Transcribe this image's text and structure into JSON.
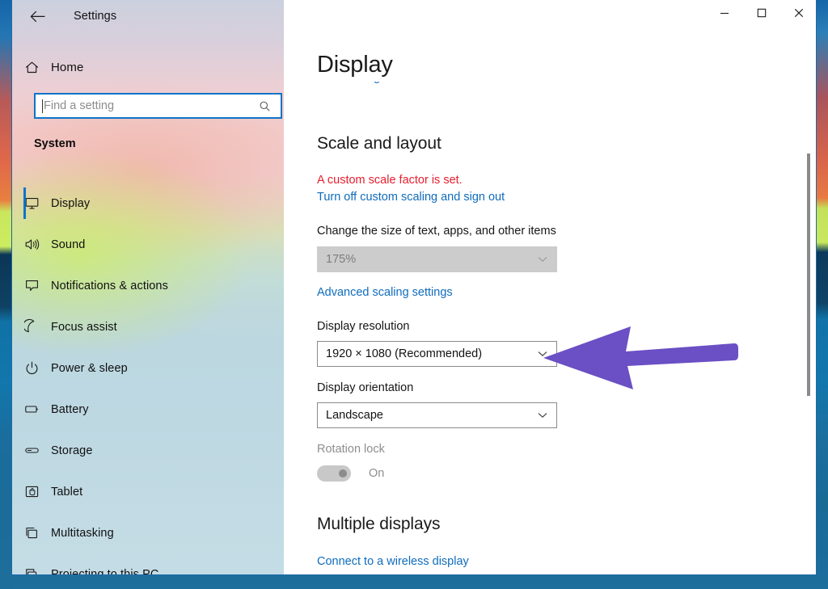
{
  "window": {
    "title": "Settings",
    "back_icon": "back-arrow-icon",
    "controls": [
      {
        "name": "minimize",
        "glyph": "minimize-icon"
      },
      {
        "name": "maximize",
        "glyph": "maximize-icon"
      },
      {
        "name": "close",
        "glyph": "close-icon"
      }
    ]
  },
  "sidebar": {
    "home_label": "Home",
    "home_icon": "home-icon",
    "search": {
      "placeholder": "Find a setting",
      "value": "",
      "icon": "search-icon"
    },
    "category": "System",
    "selected": "Display",
    "items": [
      {
        "label": "Display",
        "icon": "monitor-icon",
        "selected": true
      },
      {
        "label": "Sound",
        "icon": "speaker-icon",
        "selected": false
      },
      {
        "label": "Notifications & actions",
        "icon": "chat-bubble-icon",
        "selected": false
      },
      {
        "label": "Focus assist",
        "icon": "moon-icon",
        "selected": false
      },
      {
        "label": "Power & sleep",
        "icon": "power-icon",
        "selected": false
      },
      {
        "label": "Battery",
        "icon": "battery-icon",
        "selected": false
      },
      {
        "label": "Storage",
        "icon": "drive-icon",
        "selected": false
      },
      {
        "label": "Tablet",
        "icon": "tablet-hand-icon",
        "selected": false
      },
      {
        "label": "Multitasking",
        "icon": "windows-stack-icon",
        "selected": false
      },
      {
        "label": "Projecting to this PC",
        "icon": "projector-icon",
        "selected": false
      }
    ]
  },
  "content": {
    "page_title": "Display",
    "clipped_link_above": "HDR settings",
    "scale_section": {
      "heading": "Scale and layout",
      "warning": "A custom scale factor is set.",
      "turn_off_link": "Turn off custom scaling and sign out",
      "scale_label": "Change the size of text, apps, and other items",
      "scale_value": "175%",
      "scale_disabled": true,
      "advanced_link": "Advanced scaling settings",
      "resolution_label": "Display resolution",
      "resolution_value": "1920 × 1080 (Recommended)",
      "orientation_label": "Display orientation",
      "orientation_value": "Landscape",
      "rotation_label": "Rotation lock",
      "rotation_state": "On",
      "rotation_disabled": true
    },
    "multiple_displays": {
      "heading": "Multiple displays",
      "wireless_link": "Connect to a wireless display"
    }
  },
  "annotation": {
    "type": "arrow",
    "points_to": "Display resolution dropdown",
    "color": "#6B4FC4"
  },
  "colors": {
    "accent_blue": "#0F74C8",
    "link_blue": "#0F6CBD",
    "warning_red": "#E6202E",
    "arrow_purple": "#6B4FC4",
    "disabled_gray": "#CCCCCC"
  }
}
